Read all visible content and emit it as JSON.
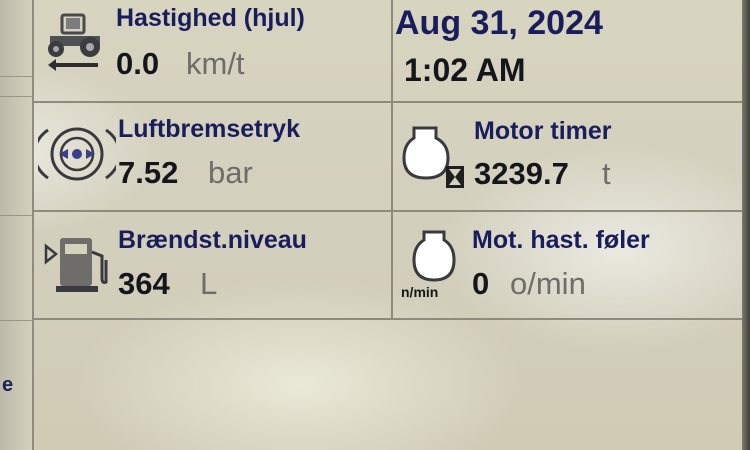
{
  "speed": {
    "label": "Hastighed (hjul)",
    "value": "0.0",
    "unit": "km/t",
    "icon": "tractor-icon"
  },
  "datetime": {
    "date": "Aug 31, 2024",
    "time": "1:02 AM"
  },
  "air_brake": {
    "label": "Luftbremsetryk",
    "value": "7.52",
    "unit": "bar",
    "icon": "air-brake-icon"
  },
  "engine_hours": {
    "label": "Motor timer",
    "value": "3239.7",
    "unit": "t",
    "icon": "engine-hourglass-icon"
  },
  "fuel_level": {
    "label": "Brændst.niveau",
    "value": "364",
    "unit": "L",
    "icon": "fuel-pump-icon"
  },
  "engine_speed": {
    "label": "Mot. hast. føler",
    "value": "0",
    "unit": "o/min",
    "icon_caption": "n/min",
    "icon": "engine-rpm-icon"
  },
  "left_panel": {
    "partial_text": "e"
  },
  "colors": {
    "label": "#1a1d5c",
    "value": "#15161c",
    "unit": "#6e6d69",
    "background": "#d4d1bd",
    "grid": "#8e8b7c"
  }
}
